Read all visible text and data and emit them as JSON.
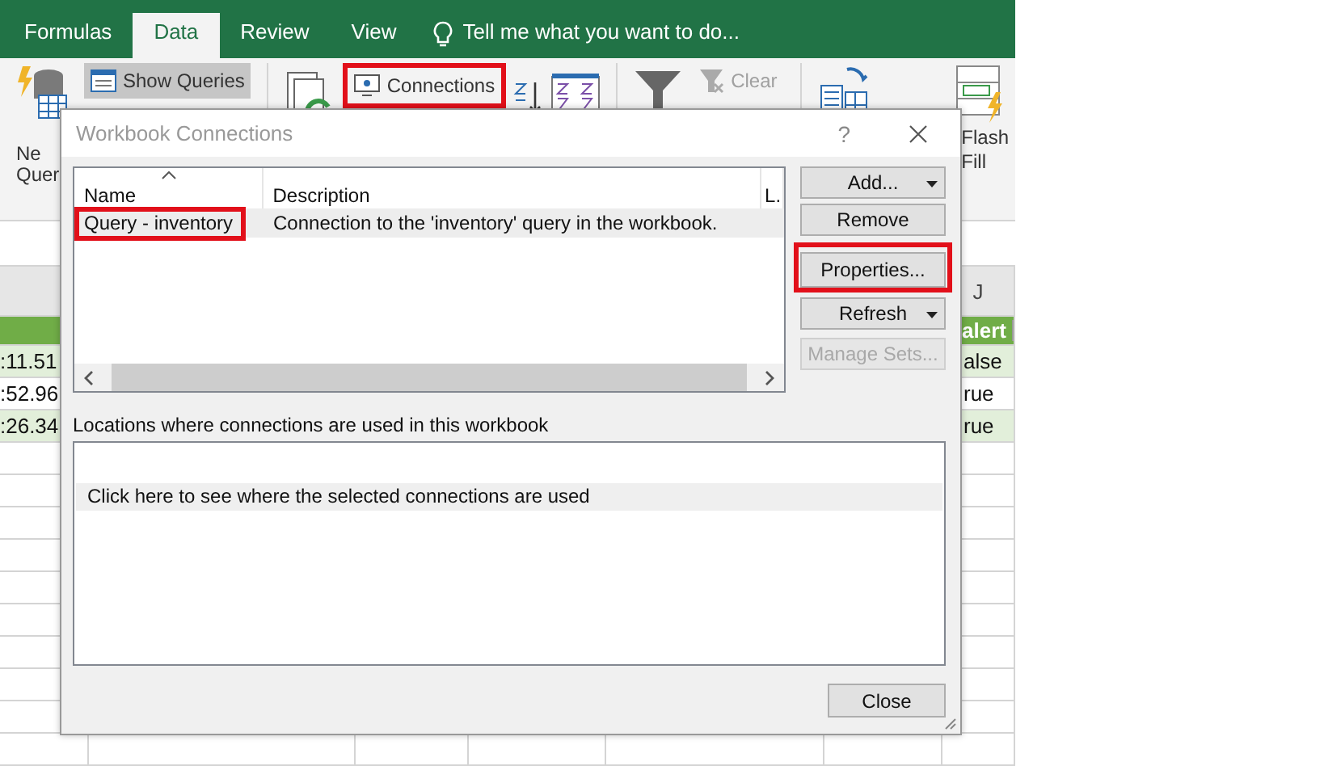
{
  "ribbon_tabs": [
    {
      "label": "Formulas",
      "selected": false
    },
    {
      "label": "Data",
      "selected": true
    },
    {
      "label": "Review",
      "selected": false
    },
    {
      "label": "View",
      "selected": false
    }
  ],
  "tell_me": {
    "placeholder": "Tell me what you want to do..."
  },
  "ribbon": {
    "new_query": [
      "Ne",
      "Quer"
    ],
    "show_queries": {
      "label": "Show Queries",
      "selected": true
    },
    "connections": {
      "label": "Connections",
      "highlighted": true
    },
    "clear": {
      "label": "Clear",
      "disabled": true
    },
    "flash_fill": [
      "Flash",
      "Fill"
    ]
  },
  "sheet": {
    "column_header": "J",
    "filter_header": "alert",
    "rows": [
      {
        "column_1": ":11.51",
        "column_j": "alse"
      },
      {
        "column_1": ":52.96",
        "column_j": "rue"
      },
      {
        "column_1": ":26.34",
        "column_j": "rue"
      }
    ]
  },
  "dialog": {
    "title": "Workbook Connections",
    "help": "?",
    "columns": [
      {
        "label": "Name",
        "sorted": true
      },
      {
        "label": "Description",
        "sorted": false
      },
      {
        "label": "L.",
        "sorted": false
      }
    ],
    "connections": [
      {
        "name": "Query - inventory",
        "description": "Connection to the 'inventory' query in the workbook.",
        "selected": true,
        "highlighted": true
      }
    ],
    "buttons": [
      {
        "label": "Add...",
        "dropdown": true,
        "disabled": false,
        "highlighted": false
      },
      {
        "label": "Remove",
        "dropdown": false,
        "disabled": false,
        "highlighted": false
      },
      {
        "label": "Properties...",
        "dropdown": false,
        "disabled": false,
        "highlighted": true
      },
      {
        "label": "Refresh",
        "dropdown": true,
        "disabled": false,
        "highlighted": false
      },
      {
        "label": "Manage Sets...",
        "dropdown": false,
        "disabled": true,
        "highlighted": false
      }
    ],
    "locations_label": "Locations where connections are used in this workbook",
    "locations_hint": "Click here to see where the selected connections are used",
    "close_button": "Close"
  }
}
